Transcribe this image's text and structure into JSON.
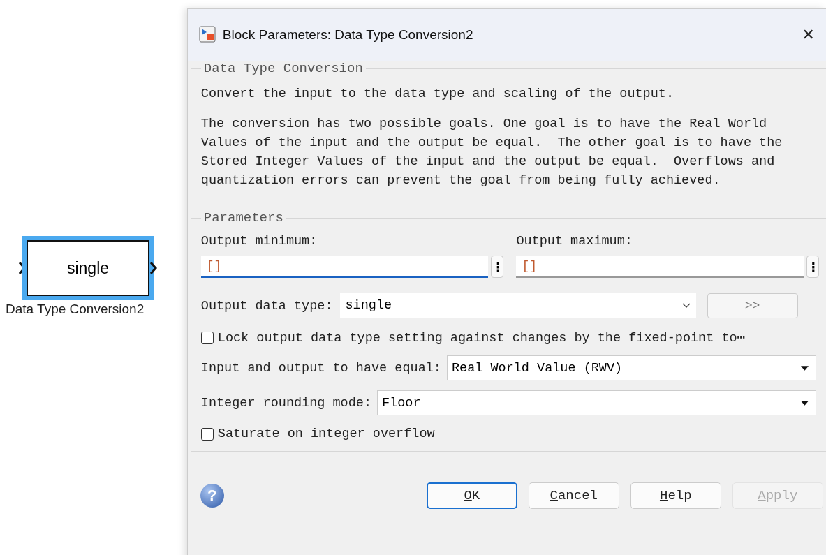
{
  "canvas": {
    "block": {
      "label": "single",
      "name": "Data Type Conversion2",
      "selected": true
    }
  },
  "window": {
    "title": "Block Parameters: Data Type Conversion2",
    "close": "✕"
  },
  "description": {
    "legend": "Data Type Conversion",
    "paragraphs": [
      "Convert the input to the data type and scaling of the output.",
      "The conversion has two possible goals. One goal is to have the Real World Values of the input and the output be equal.  The other goal is to have the Stored Integer Values of the input and the output be equal.  Overflows and quantization errors can prevent the goal from being fully achieved."
    ]
  },
  "parameters": {
    "legend": "Parameters",
    "range_fields": [
      {
        "label": "Output minimum:",
        "value": "[]",
        "focused": true,
        "menu": "⋮"
      },
      {
        "label": "Output maximum:",
        "value": "[]",
        "focused": false,
        "menu": "⋮"
      }
    ],
    "data_type": {
      "label": "Output data type:",
      "value": "single",
      "assistant": ">>"
    },
    "lock": {
      "label": "Lock output data type setting against changes by the fixed-point to⋯",
      "checked": false
    },
    "dropdowns": [
      {
        "label": "Input and output to have equal:",
        "value": "Real World Value (RWV)"
      },
      {
        "label": "Integer rounding mode:",
        "value": "Floor"
      }
    ],
    "saturate": {
      "label": "Saturate on integer overflow",
      "checked": false
    }
  },
  "help_icon": "?",
  "buttons": [
    {
      "label": "OK",
      "default": true,
      "disabled": false
    },
    {
      "label": "Cancel",
      "default": false,
      "disabled": false
    },
    {
      "label": "Help",
      "default": false,
      "disabled": false
    },
    {
      "label": "Apply",
      "default": false,
      "disabled": true
    }
  ]
}
